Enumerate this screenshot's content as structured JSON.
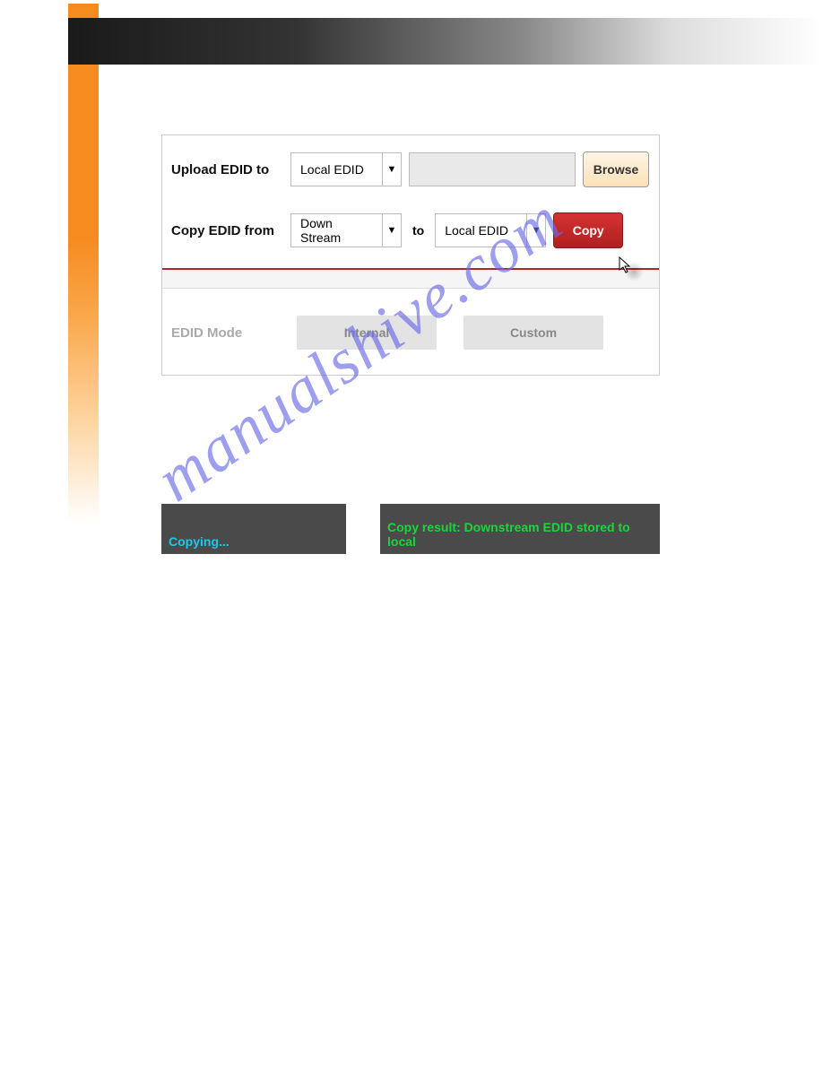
{
  "panel": {
    "upload": {
      "label": "Upload EDID to",
      "dest_selected": "Local EDID",
      "file_value": "",
      "browse_label": "Browse"
    },
    "copy": {
      "label": "Copy EDID from",
      "from_selected": "Down Stream",
      "to_label": "to",
      "to_selected": "Local EDID",
      "copy_label": "Copy"
    },
    "mode": {
      "label": "EDID Mode",
      "option1": "Internal",
      "option2": "Custom"
    }
  },
  "status": {
    "copying": "Copying...",
    "result": "Copy result: Downstream EDID stored to local"
  },
  "watermark": "manualshive.com"
}
